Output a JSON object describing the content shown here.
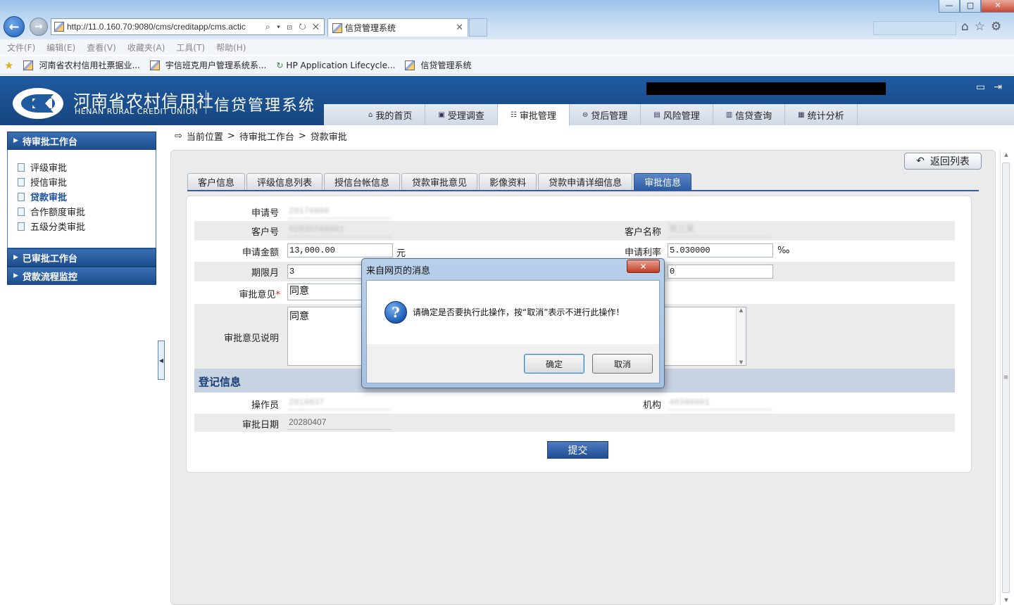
{
  "browser": {
    "url": "http://11.0.160.70:9080/cms/creditapp/cms.actic",
    "url_tools": "⌕ ▾ ⊡ ↻ ✕",
    "tab_title": "信贷管理系统",
    "tab_close": "✕",
    "menu": [
      "文件(F)",
      "编辑(E)",
      "查看(V)",
      "收藏夹(A)",
      "工具(T)",
      "帮助(H)"
    ],
    "favorites": [
      "河南省农村信用社票据业...",
      "宇信班克用户管理系统系...",
      "HP Application Lifecycle...",
      "信贷管理系统"
    ],
    "window_buttons": {
      "min": "—",
      "max": "□",
      "close": "✕"
    }
  },
  "header": {
    "org_cn": "河南省农村信用社",
    "org_en": "HENAN RURAL CREDIT UNION",
    "system_name": "信贷管理系统",
    "nav": [
      {
        "label": "我的首页",
        "icon": "home-icon",
        "glyph": "⌂"
      },
      {
        "label": "受理调查",
        "icon": "survey-icon",
        "glyph": "▣"
      },
      {
        "label": "审批管理",
        "icon": "approve-icon",
        "glyph": "☷",
        "active": true
      },
      {
        "label": "贷后管理",
        "icon": "postloan-icon",
        "glyph": "⊜"
      },
      {
        "label": "风险管理",
        "icon": "risk-icon",
        "glyph": "▤"
      },
      {
        "label": "信贷查询",
        "icon": "query-icon",
        "glyph": "▥"
      },
      {
        "label": "统计分析",
        "icon": "stats-icon",
        "glyph": "▦"
      }
    ]
  },
  "sidebar": {
    "section1": "待审批工作台",
    "items": [
      "评级审批",
      "授信审批",
      "贷款审批",
      "合作额度审批",
      "五级分类审批"
    ],
    "selected": "贷款审批",
    "section2": "已审批工作台",
    "section3": "贷款流程监控"
  },
  "breadcrumb": {
    "prefix": "当前位置",
    "sep": ">",
    "level1": "待审批工作台",
    "level2": "贷款审批"
  },
  "return_button": "返回列表",
  "tabs": [
    "客户信息",
    "评级信息列表",
    "授信台帐信息",
    "贷款审批意见",
    "影像资料",
    "贷款申请详细信息",
    "审批信息"
  ],
  "active_tab": "审批信息",
  "form": {
    "app_no_label": "申请号",
    "app_no": "20170806",
    "cust_no_label": "客户号",
    "cust_no": "02835568001",
    "cust_name_label": "客户名称",
    "cust_name": "张三某",
    "amount_label": "申请金额",
    "amount": "13,000.00",
    "amount_unit": "元",
    "rate_label": "申请利率",
    "rate": "5.030000",
    "rate_unit": "‰",
    "term_label": "期限月",
    "term": "3",
    "other_value": "0",
    "opinion_label": "审批意见",
    "required_mark": "*",
    "opinion": "同意",
    "opinion_desc_label": "审批意见说明",
    "opinion_desc": "同意",
    "reg_title": "登记信息",
    "operator_label": "操作员",
    "operator": "2018037",
    "org_label": "机构",
    "org": "40380001",
    "date_label": "审批日期",
    "date": "20280407",
    "submit": "提交"
  },
  "dialog": {
    "title": "来自网页的消息",
    "close": "✕",
    "message": "请确定是否要执行此操作，按“取消”表示不进行此操作！",
    "ok": "确定",
    "cancel": "取消"
  },
  "colors": {
    "brand_blue": "#1d4e8f",
    "tab_active": "#2f5ea4",
    "dialog_frame": "#a5c1e2"
  }
}
